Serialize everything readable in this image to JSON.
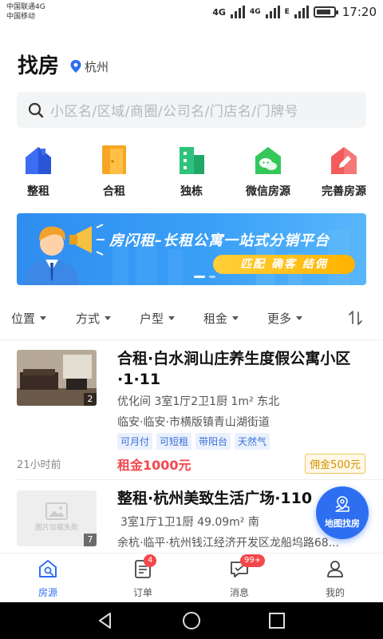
{
  "status_bar": {
    "carrier_1": "中国联通4G",
    "carrier_2": "中国移动",
    "net_1": "4G",
    "net_2": "4G",
    "net_3": "E",
    "time": "17:20"
  },
  "header": {
    "title": "找房",
    "city": "杭州"
  },
  "search": {
    "placeholder": "小区名/区域/商圈/公司名/门店名/门牌号"
  },
  "categories": [
    {
      "label": "整租",
      "icon": "house-icon",
      "color": "#3d6df2"
    },
    {
      "label": "合租",
      "icon": "door-icon",
      "color": "#f6a623"
    },
    {
      "label": "独栋",
      "icon": "building-icon",
      "color": "#2fc27a"
    },
    {
      "label": "微信房源",
      "icon": "wechat-house-icon",
      "color": "#34c759"
    },
    {
      "label": "完善房源",
      "icon": "edit-house-icon",
      "color": "#f25c5c"
    }
  ],
  "banner": {
    "title": "房闪租–长租公寓一站式分销平台",
    "tagline": "匹配  确客  结佣"
  },
  "filters": [
    "位置",
    "方式",
    "户型",
    "租金",
    "更多"
  ],
  "listings": [
    {
      "title": "合租·白水涧山庄养生度假公寓小区·1·11",
      "layout": "优化间 3室1厅2卫1厨 1m² 东北",
      "address": "临安·临安·市横版镇青山湖街道",
      "tags": [
        "可月付",
        "可短租",
        "带阳台",
        "天然气"
      ],
      "time": "21小时前",
      "price": "租金1000元",
      "commission": "佣金500元",
      "image_count": "2"
    },
    {
      "title": "整租·杭州美致生活广场·110",
      "layout": "3室1厅1卫1厨 49.09m² 南",
      "address": "余杭·临平·杭州钱江经济开发区龙船坞路68...",
      "image_count": "7",
      "image_placeholder": "图片加载失败"
    }
  ],
  "map_button": {
    "label": "地图找房"
  },
  "tabs": [
    {
      "label": "房源",
      "active": true
    },
    {
      "label": "订单",
      "badge": "4"
    },
    {
      "label": "消息",
      "badge": "99+"
    },
    {
      "label": "我的"
    }
  ],
  "colors": {
    "primary": "#2e6ff2",
    "price": "#f2474d",
    "commission": "#d59200"
  }
}
